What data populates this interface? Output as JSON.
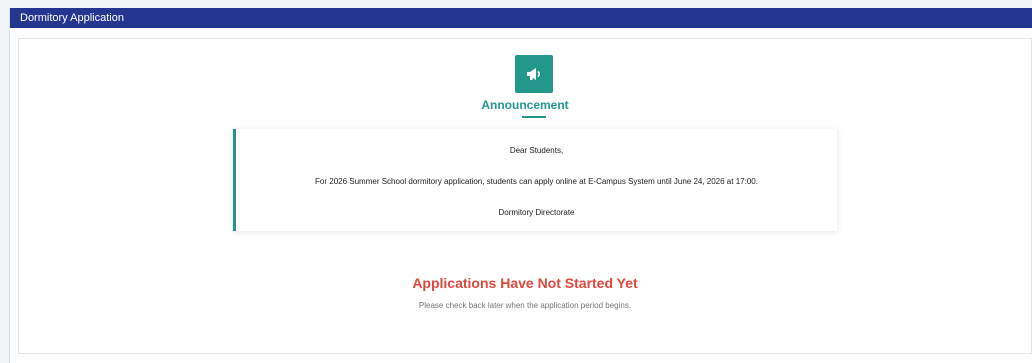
{
  "header": {
    "title": "Dormitory Application"
  },
  "announcement": {
    "icon": "megaphone-icon",
    "title": "Announcement",
    "greeting": "Dear Students,",
    "message": "For 2026 Summer School dormitory application, students can apply online at E-Campus System until June 24, 2026 at 17:00.",
    "signature": "Dormitory Directorate"
  },
  "status": {
    "title": "Applications Have Not Started Yet",
    "subtitle": "Please check back later when the application period begins."
  },
  "colors": {
    "header_bg": "#24368f",
    "accent": "#23978b",
    "status_red": "#e0473c"
  }
}
